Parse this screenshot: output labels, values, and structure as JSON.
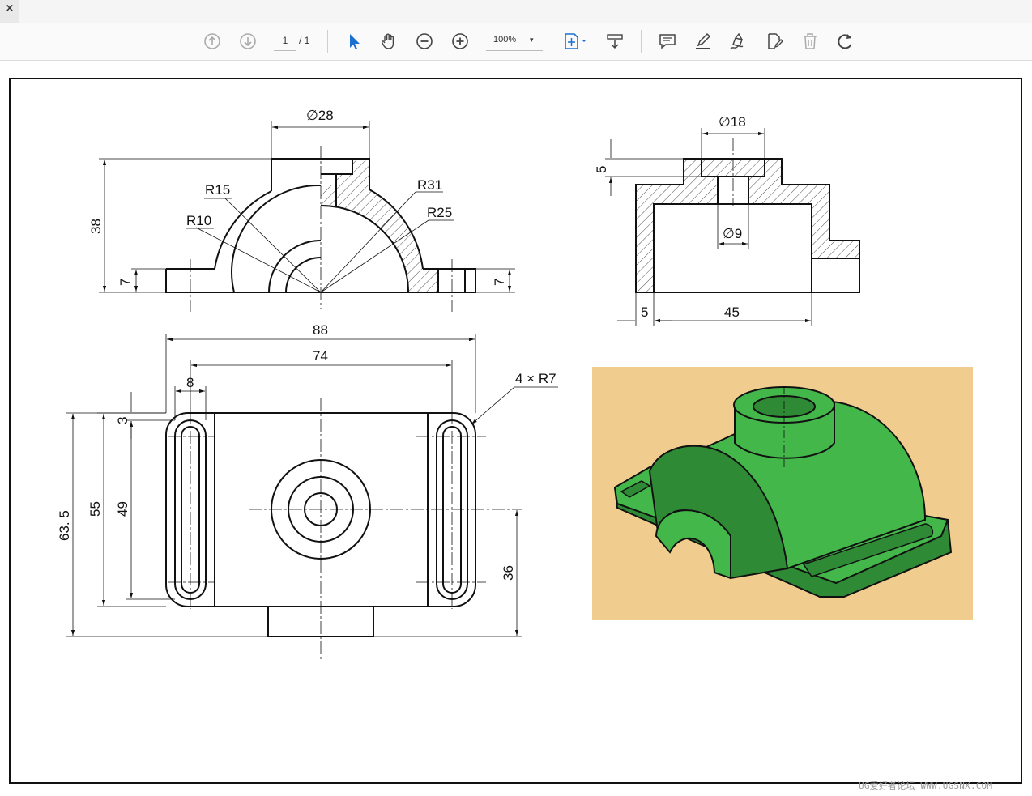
{
  "tab": {
    "close_glyph": "×"
  },
  "toolbar": {
    "page_current": "1",
    "page_total": "/ 1",
    "zoom": "100%",
    "zoom_caret": "▾",
    "icons": [
      "prev-page-icon",
      "next-page-icon",
      "select-arrow-icon",
      "hand-tool-icon",
      "zoom-out-icon",
      "zoom-in-icon",
      "fit-page-icon",
      "scroll-mode-icon",
      "comment-icon",
      "highlight-icon",
      "draw-icon",
      "edit-pdf-icon",
      "delete-icon",
      "rotate-icon"
    ]
  },
  "drawing": {
    "front_view": {
      "d28": "∅28",
      "r15": "R15",
      "r31": "R31",
      "r10": "R10",
      "r25": "R25",
      "h38": "38",
      "h7_left": "7",
      "h7_right": "7"
    },
    "side_view": {
      "d18": "∅18",
      "d9": "∅9",
      "h5": "5",
      "w5": "5",
      "w45": "45"
    },
    "top_view": {
      "w88": "88",
      "w74": "74",
      "w8": "8",
      "h3": "3",
      "r7": "4 × R7",
      "h63_5": "63. 5",
      "h55": "55",
      "h49": "49",
      "h36": "36"
    }
  },
  "render_3d": {
    "background": "#f0cd8f",
    "body_color": "#44b74a",
    "shade_color": "#2f8a35"
  },
  "watermark": "UG爱好者论坛 WWW.UGSNX.COM"
}
